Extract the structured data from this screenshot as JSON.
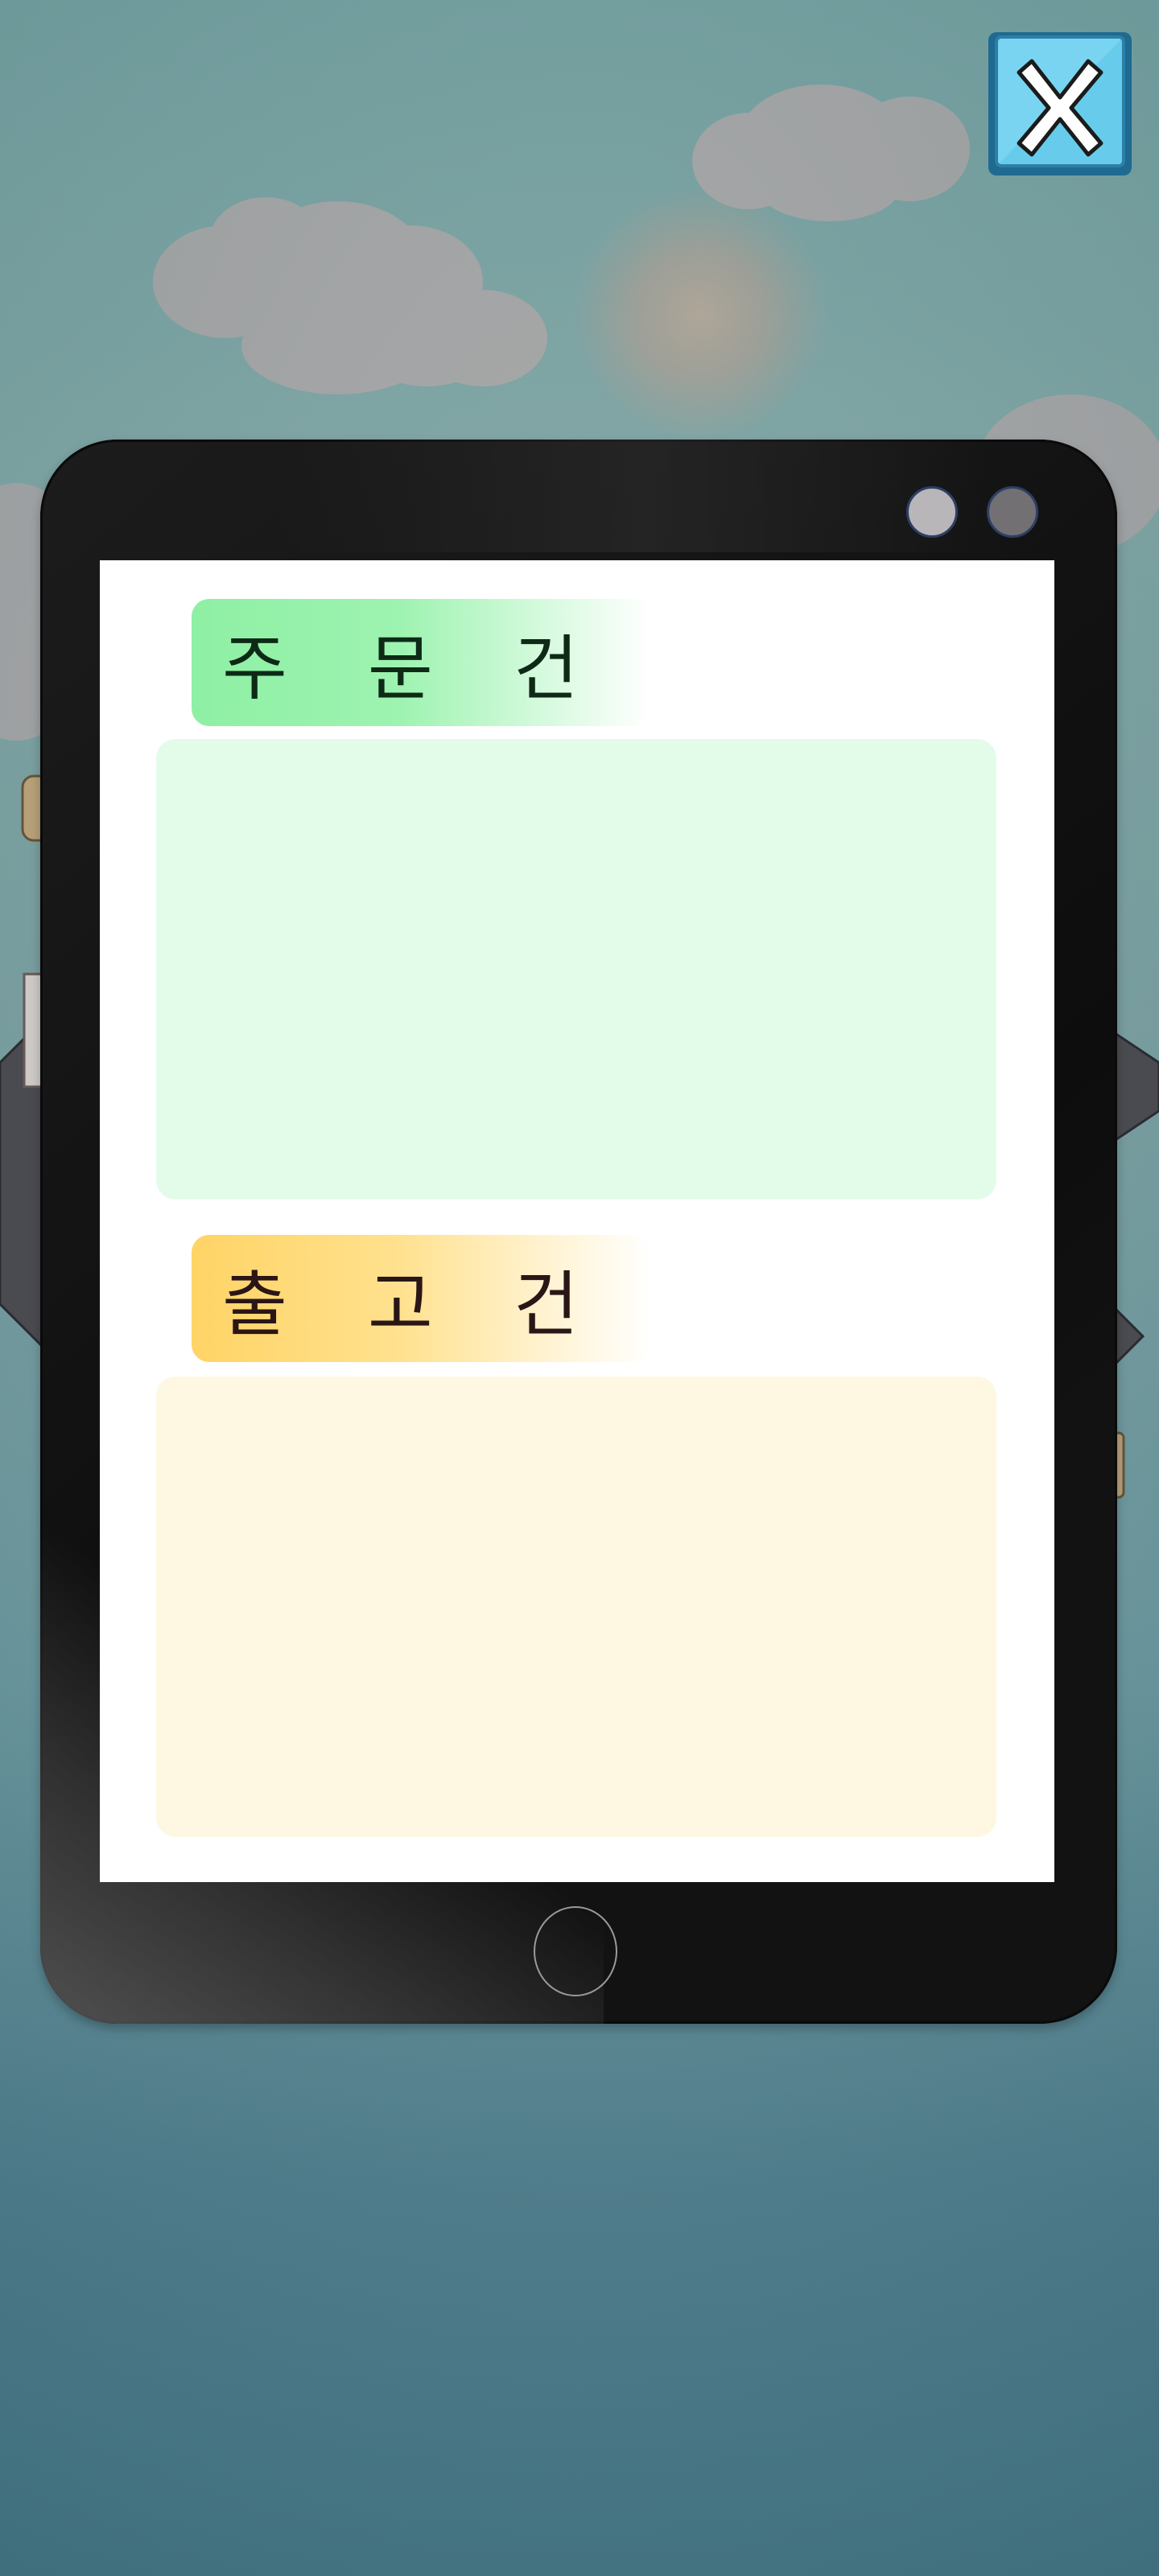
{
  "close_button": {
    "icon": "close-icon",
    "label": "X"
  },
  "tablet": {
    "sections": [
      {
        "title": "주 문 건",
        "accent": "#8ef0a4",
        "panel_color": "#e3fcea",
        "items": []
      },
      {
        "title": "출 고 건",
        "accent": "#ffd466",
        "panel_color": "#fef8e3",
        "items": []
      }
    ]
  }
}
